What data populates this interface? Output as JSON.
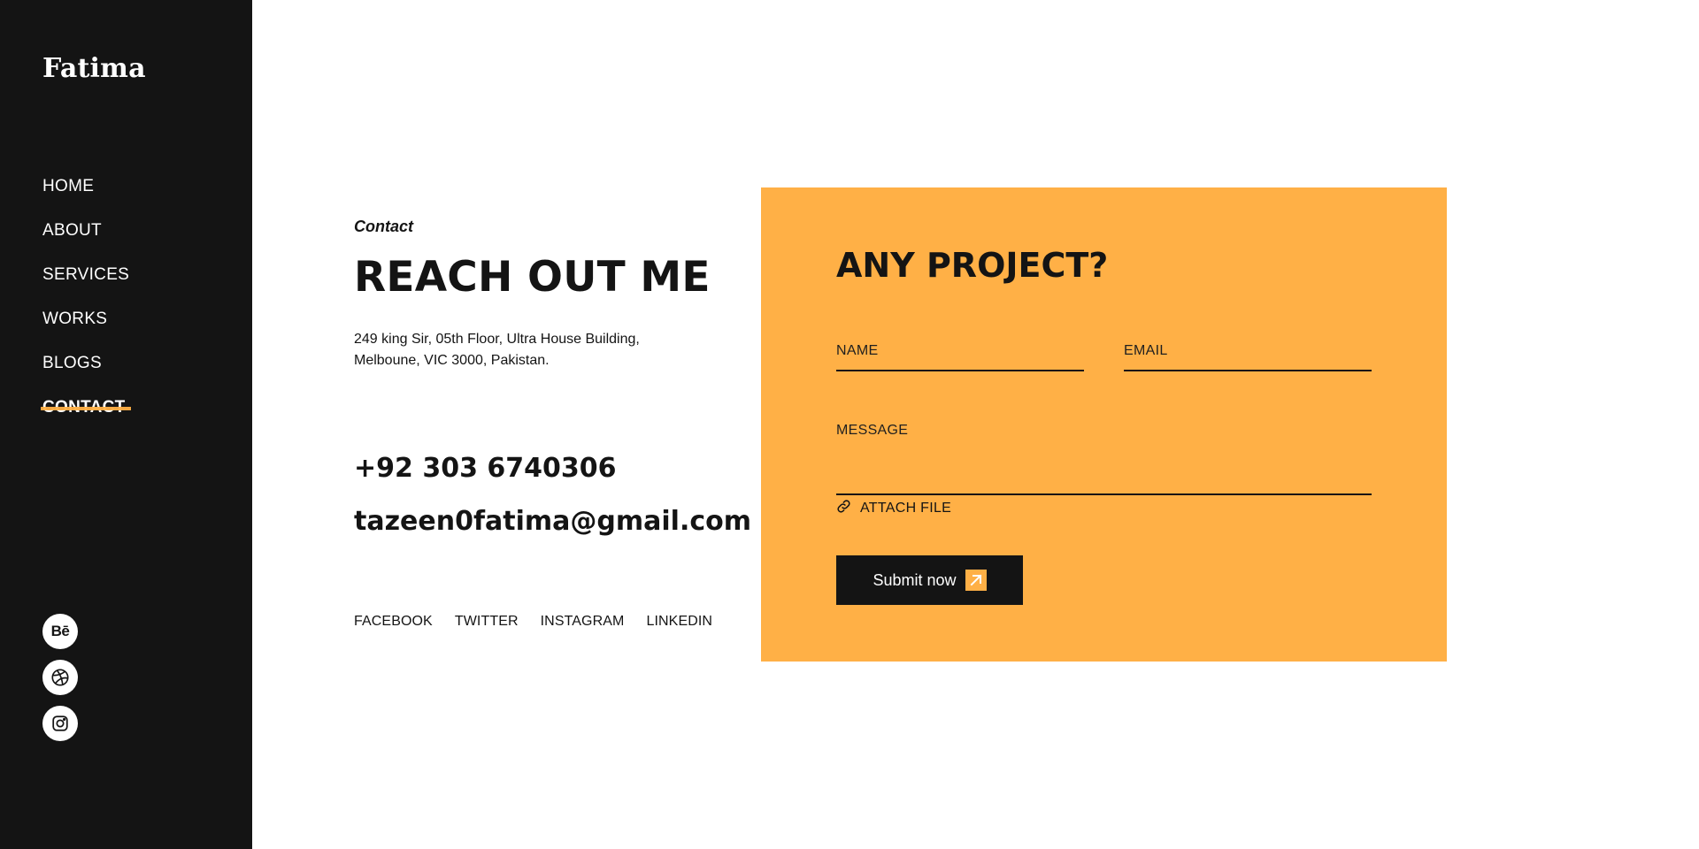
{
  "brand": {
    "name": "Fatima"
  },
  "nav": {
    "items": [
      {
        "label": "HOME"
      },
      {
        "label": "ABOUT"
      },
      {
        "label": "SERVICES"
      },
      {
        "label": "WORKS"
      },
      {
        "label": "BLOGS"
      },
      {
        "label": "CONTACT",
        "active": true
      }
    ]
  },
  "social_icons": [
    "behance-icon",
    "dribbble-icon",
    "instagram-icon"
  ],
  "social_icons_text": {
    "behance": "Bē"
  },
  "contact": {
    "eyebrow": "Contact",
    "headline": "REACH OUT ME",
    "address_line1": "249 king Sir, 05th Floor, Ultra House Building,",
    "address_line2": "Melboune, VIC 3000, Pakistan.",
    "phone": "+92 303 6740306",
    "email": "tazeen0fatima@gmail.com",
    "links": [
      "FACEBOOK",
      "TWITTER",
      "INSTAGRAM",
      "LINKEDIN"
    ]
  },
  "form": {
    "title": "ANY PROJECT?",
    "name_placeholder": "NAME",
    "email_placeholder": "EMAIL",
    "message_placeholder": "MESSAGE",
    "attach_label": "ATTACH FILE",
    "submit_label": "Submit now"
  },
  "colors": {
    "accent": "#ffb046",
    "dark": "#141414",
    "background": "#ffffff"
  }
}
